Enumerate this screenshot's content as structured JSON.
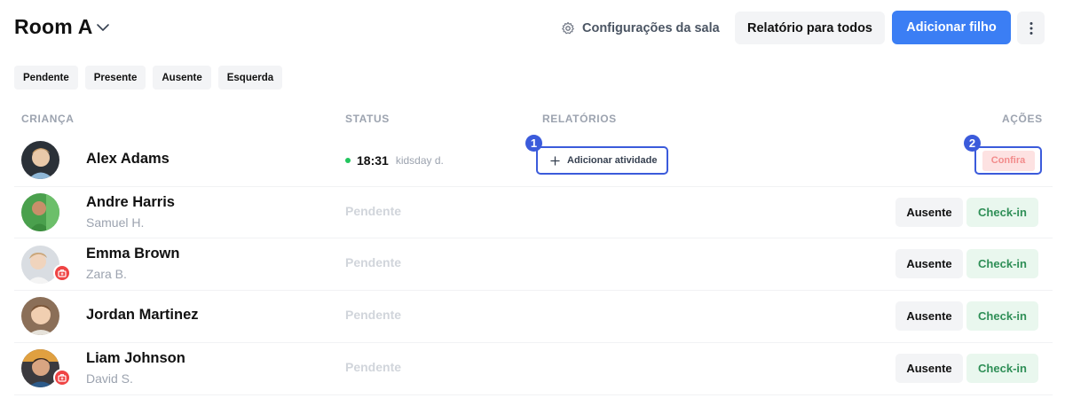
{
  "header": {
    "room_title": "Room A",
    "settings_label": "Configurações da sala",
    "report_label": "Relatório para todos",
    "add_child_label": "Adicionar filho"
  },
  "filters": [
    "Pendente",
    "Presente",
    "Ausente",
    "Esquerda"
  ],
  "columns": {
    "child": "CRIANÇA",
    "status": "STATUS",
    "reports": "RELATÓRIOS",
    "actions": "AÇÕES"
  },
  "rows": [
    {
      "name": "Alex Adams",
      "guardian": "",
      "status_time": "18:31",
      "status_by": "kidsday d.",
      "report_action": "Adicionar atividade",
      "action": "Confira",
      "markers": [
        "1",
        "2"
      ]
    },
    {
      "name": "Andre Harris",
      "guardian": "Samuel H.",
      "status": "Pendente",
      "absent": "Ausente",
      "checkin": "Check-in"
    },
    {
      "name": "Emma Brown",
      "guardian": "Zara B.",
      "status": "Pendente",
      "absent": "Ausente",
      "checkin": "Check-in"
    },
    {
      "name": "Jordan Martinez",
      "guardian": "",
      "status": "Pendente",
      "absent": "Ausente",
      "checkin": "Check-in"
    },
    {
      "name": "Liam Johnson",
      "guardian": "David S.",
      "status": "Pendente",
      "absent": "Ausente",
      "checkin": "Check-in"
    }
  ],
  "icons": {
    "room_dropdown": "chevron-down-icon",
    "settings": "gear-icon",
    "more": "more-vertical-icon",
    "add": "plus-icon",
    "allergy": "medical-bag-icon"
  },
  "colors": {
    "primary": "#3b7ef4",
    "highlight": "#3b5bdb",
    "present_dot": "#22c55e",
    "confirm_bg": "#fde2e2",
    "checkin_bg": "#e9f7ee",
    "checkin_text": "#2f8f57",
    "allergy_badge": "#ef4444"
  }
}
